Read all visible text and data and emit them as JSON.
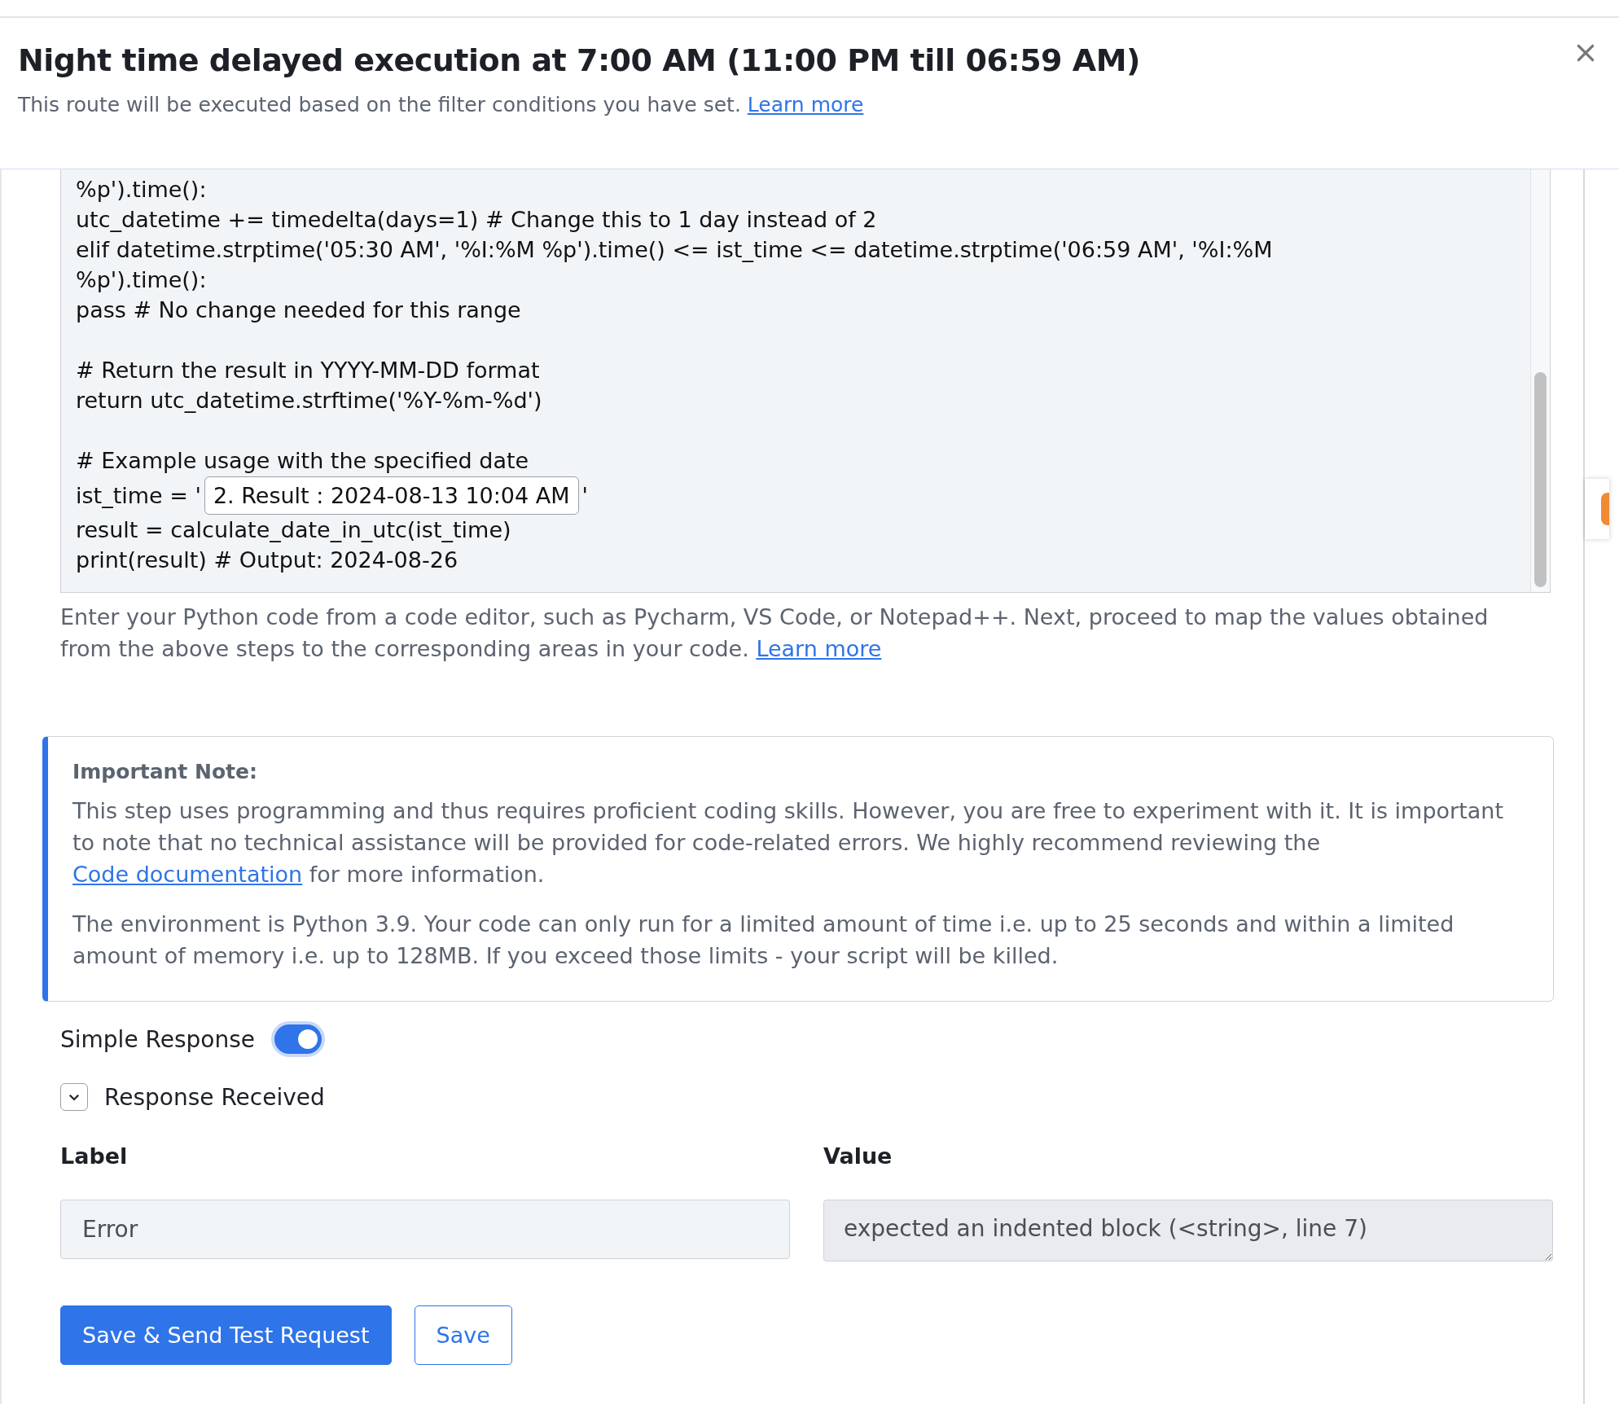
{
  "header": {
    "title": "Night time delayed execution at 7:00 AM (11:00 PM till 06:59 AM)",
    "subtitle": "This route will be executed based on the filter conditions you have set.",
    "subtitle_link": "Learn more"
  },
  "code_lines": [
    {
      "kind": "text",
      "text": "%p').time():"
    },
    {
      "kind": "text",
      "text": "utc_datetime += timedelta(days=1) # Change this to 1 day instead of 2"
    },
    {
      "kind": "text",
      "text": "elif datetime.strptime('05:30 AM', '%I:%M %p').time() <= ist_time <= datetime.strptime('06:59 AM', '%I:%M"
    },
    {
      "kind": "text",
      "text": "%p').time():"
    },
    {
      "kind": "text",
      "text": "pass # No change needed for this range"
    },
    {
      "kind": "blank"
    },
    {
      "kind": "text",
      "text": "# Return the result in YYYY-MM-DD format"
    },
    {
      "kind": "text",
      "text": "return utc_datetime.strftime('%Y-%m-%d')"
    },
    {
      "kind": "blank"
    },
    {
      "kind": "text",
      "text": "# Example usage with the specified date"
    },
    {
      "kind": "mapped",
      "before": "ist_time = '",
      "token": "2. Result : 2024-08-13 10:04 AM",
      "after": "'"
    },
    {
      "kind": "text",
      "text": "result = calculate_date_in_utc(ist_time)"
    },
    {
      "kind": "text",
      "text": "print(result) # Output: 2024-08-26"
    }
  ],
  "help": {
    "text": "Enter your Python code from a code editor, such as Pycharm, VS Code, or Notepad++. Next, proceed to map the values obtained from the above steps to the corresponding areas in your code.",
    "link": "Learn more"
  },
  "note": {
    "title": "Important Note:",
    "para1_before": "This step uses programming and thus requires proficient coding skills. However, you are free to experiment with it. It is important to note that no technical assistance will be provided for code-related errors. We highly recommend reviewing the",
    "para1_link": "Code documentation",
    "para1_after": "for more information.",
    "para2": "The environment is Python 3.9. Your code can only run for a limited amount of time i.e. up to 25 seconds and within a limited amount of memory i.e. up to 128MB. If you exceed those limits - your script will be killed."
  },
  "simple_response": {
    "label": "Simple Response",
    "on": true
  },
  "response_received": {
    "label": "Response Received",
    "expanded": true
  },
  "fields": [
    {
      "heading": "Label",
      "value": "Error",
      "kind": "input"
    },
    {
      "heading": "Value",
      "value": "expected an indented block (<string>, line 7)",
      "kind": "textarea"
    }
  ],
  "buttons": [
    {
      "label": "Save & Send Test Request",
      "kind": "primary"
    },
    {
      "label": "Save",
      "kind": "outline"
    }
  ]
}
